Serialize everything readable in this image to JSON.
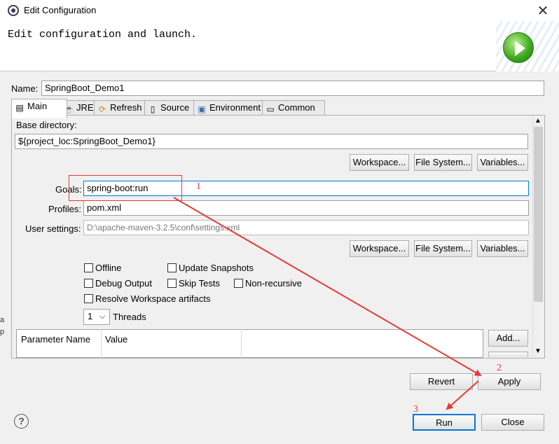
{
  "window": {
    "title": "Edit Configuration",
    "subtitle": "Edit configuration and launch."
  },
  "name_label": "Name:",
  "name_value": "SpringBoot_Demo1",
  "tabs": [
    {
      "label": "Main",
      "icon": "main-tab-icon"
    },
    {
      "label": "JRE",
      "icon": "jre-tab-icon"
    },
    {
      "label": "Refresh",
      "icon": "refresh-tab-icon"
    },
    {
      "label": "Source",
      "icon": "source-tab-icon"
    },
    {
      "label": "Environment",
      "icon": "environment-tab-icon"
    },
    {
      "label": "Common",
      "icon": "common-tab-icon"
    }
  ],
  "main": {
    "base_dir_label": "Base directory:",
    "base_dir_value": "${project_loc:SpringBoot_Demo1}",
    "workspace_btn": "Workspace...",
    "filesystem_btn": "File System...",
    "variables_btn": "Variables...",
    "goals_label": "Goals:",
    "goals_value": "spring-boot:run",
    "profiles_label": "Profiles:",
    "profiles_value": "pom.xml",
    "user_settings_label": "User settings:",
    "user_settings_value": "D:\\apache-maven-3.2.5\\conf\\settings.xml",
    "checkboxes": {
      "offline": "Offline",
      "update_snapshots": "Update Snapshots",
      "debug_output": "Debug Output",
      "skip_tests": "Skip Tests",
      "non_recursive": "Non-recursive",
      "resolve_workspace": "Resolve Workspace artifacts"
    },
    "threads_value": "1",
    "threads_label": "Threads",
    "param_headers": [
      "Parameter Name",
      "Value"
    ],
    "add_btn": "Add..."
  },
  "footer": {
    "revert": "Revert",
    "apply": "Apply",
    "run": "Run",
    "close": "Close",
    "help": "?"
  },
  "annotations": [
    "1",
    "2",
    "3"
  ],
  "edge_letters": [
    "a",
    "p"
  ],
  "colors": {
    "annotation_red": "#e53935",
    "focus_blue": "#0078d7"
  }
}
